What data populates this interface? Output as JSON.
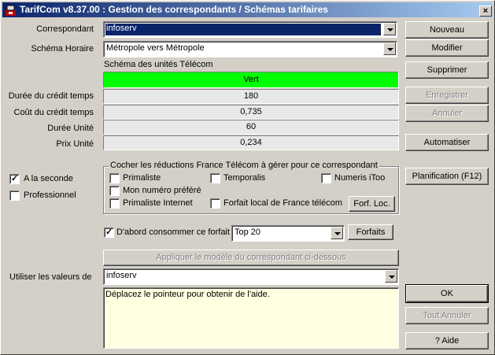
{
  "window": {
    "title": "TarifCom v8.37.00 : Gestion des correspondants / Schémas tarifaires",
    "close": "×"
  },
  "form": {
    "correspondant_label": "Correspondant",
    "correspondant_value": "infoserv",
    "schema_horaire_label": "Schéma Horaire",
    "schema_horaire_value": "Métropole vers Métropole",
    "unites_label": "Schéma des unités Télécom",
    "unites_value": "Vert",
    "unites_color": "#00ff00",
    "rows": [
      {
        "label": "Durée du crédit temps",
        "value": "180"
      },
      {
        "label": "Coût du crédit temps",
        "value": "0,735"
      },
      {
        "label": "Durée Unité",
        "value": "60"
      },
      {
        "label": "Prix Unité",
        "value": "0,234"
      }
    ],
    "a_la_seconde": "A la seconde",
    "professionnel": "Professionnel"
  },
  "reductions": {
    "caption": "Cocher les réductions France Télécom à gérer pour ce correspondant",
    "primaliste": "Primaliste",
    "temporalis": "Temporalis",
    "numeris": "Numeris iToo",
    "mon_numero": "Mon numéro préféré",
    "primaliste_internet": "Primaliste Internet",
    "forfait_local": "Forfait local de France télécom",
    "forf_loc_button": "Forf. Loc."
  },
  "forfait": {
    "label": "D'abord consommer ce forfait",
    "value": "Top 20",
    "button": "Forfaits"
  },
  "appliquer_button": "Appliquer le modèle du correspondant ci-dessous",
  "utiliser": {
    "label": "Utiliser les valeurs de",
    "value": "infoserv"
  },
  "help_text": "Déplacez le pointeur pour obtenir de l'aide.",
  "buttons": {
    "nouveau": "Nouveau",
    "modifier": "Modifier",
    "supprimer": "Supprimer",
    "enregistrer": "Enregistrer",
    "annuler": "Annuler",
    "automatiser": "Automatiser",
    "planification": "Planification (F12)",
    "ok": "OK",
    "tout_annuler": "Tout Annuler",
    "aide": "? Aide"
  }
}
